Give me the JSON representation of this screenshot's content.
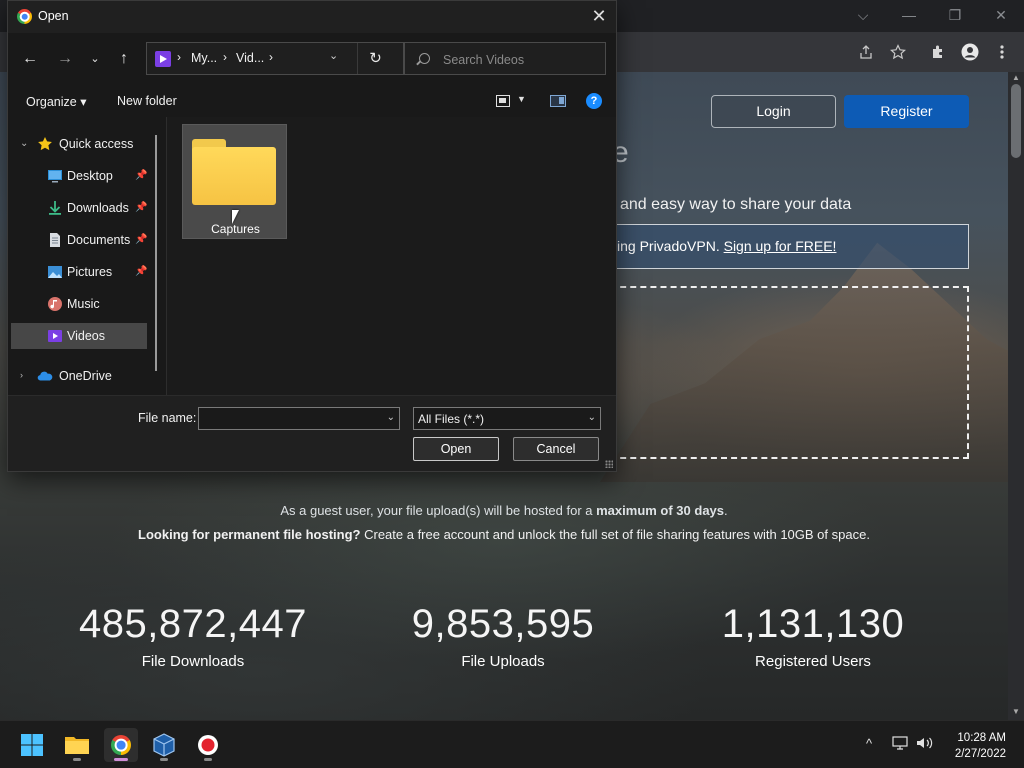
{
  "dialog": {
    "title": "Open",
    "breadcrumb": [
      "My...",
      "Vid..."
    ],
    "search_placeholder": "Search Videos",
    "toolbar": {
      "organize": "Organize ▾",
      "new_folder": "New folder"
    },
    "nav_items": [
      {
        "label": "Quick access",
        "icon": "star-icon"
      },
      {
        "label": "Desktop",
        "icon": "desktop-icon",
        "pinned": true
      },
      {
        "label": "Downloads",
        "icon": "download-icon",
        "pinned": true
      },
      {
        "label": "Documents",
        "icon": "document-icon",
        "pinned": true
      },
      {
        "label": "Pictures",
        "icon": "pictures-icon",
        "pinned": true
      },
      {
        "label": "Music",
        "icon": "music-icon"
      },
      {
        "label": "Videos",
        "icon": "videos-icon",
        "selected": true
      },
      {
        "label": "OneDrive",
        "icon": "cloud-icon"
      }
    ],
    "files": [
      {
        "name": "Captures",
        "type": "folder"
      }
    ],
    "file_name_label": "File name:",
    "file_name_value": "",
    "file_type": "All Files (*.*)",
    "open_button": "Open",
    "cancel_button": "Cancel"
  },
  "page": {
    "login": "Login",
    "register": "Register",
    "heading_fragment": "e",
    "tagline": "and easy way to share your data",
    "vpn_prefix": "ing PrivadoVPN. ",
    "vpn_link": "Sign up for FREE!",
    "guest_note_prefix": "As a guest user, your file upload(s) will be hosted for a ",
    "guest_note_bold": "maximum of 30 days",
    "guest_note_suffix": ".",
    "perm_note_bold": "Looking for permanent file hosting?",
    "perm_note_text": " Create a free account and unlock the full set of file sharing features with 10GB of space.",
    "stats": [
      {
        "value": "485,872,447",
        "label": "File Downloads"
      },
      {
        "value": "9,853,595",
        "label": "File Uploads"
      },
      {
        "value": "1,131,130",
        "label": "Registered Users"
      }
    ]
  },
  "taskbar": {
    "time": "10:28 AM",
    "date": "2/27/2022"
  },
  "colors": {
    "accent_blue": "#0d5bb5",
    "folder_yellow": "#f6c343",
    "videos_purple": "#7b3fe4"
  }
}
